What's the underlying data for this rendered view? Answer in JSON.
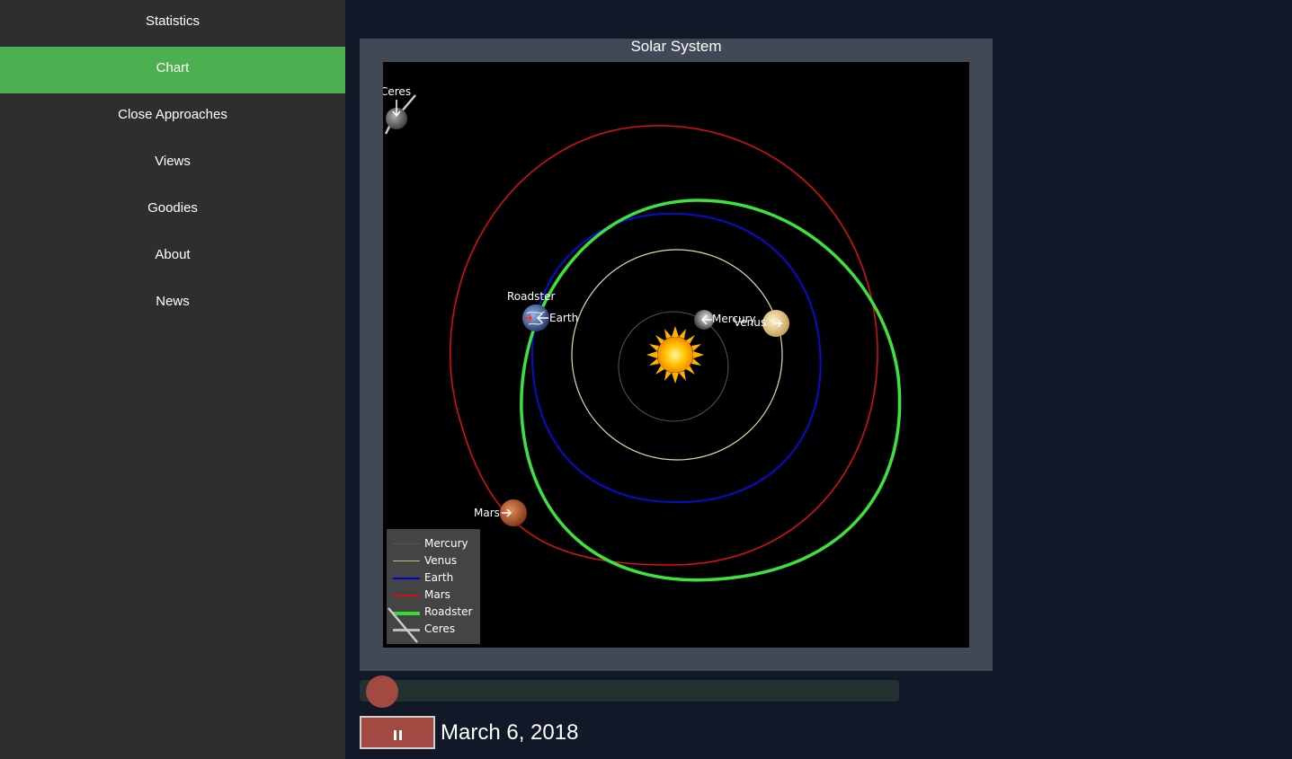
{
  "sidebar": {
    "items": [
      {
        "label": "Statistics",
        "active": false
      },
      {
        "label": "Chart",
        "active": true
      },
      {
        "label": "Close Approaches",
        "active": false
      },
      {
        "label": "Views",
        "active": false
      },
      {
        "label": "Goodies",
        "active": false
      },
      {
        "label": "About",
        "active": false
      },
      {
        "label": "News",
        "active": false
      }
    ],
    "accent_color": "#4caf50"
  },
  "chart": {
    "title": "Solar System",
    "legend": [
      {
        "name": "Mercury",
        "color": "#555555"
      },
      {
        "name": "Venus",
        "color": "#c8b878"
      },
      {
        "name": "Earth",
        "color": "#0000cc"
      },
      {
        "name": "Mars",
        "color": "#cc1111"
      },
      {
        "name": "Roadster",
        "color": "#33dd33"
      },
      {
        "name": "Ceres",
        "color": "#bbbbbb"
      }
    ]
  },
  "chart_data": {
    "type": "scatter",
    "title": "Solar System",
    "xlabel": "",
    "ylabel": "",
    "grid": false,
    "legend_position": "bottom-left",
    "series": [
      {
        "name": "Mercury",
        "kind": "orbit",
        "color": "#555555"
      },
      {
        "name": "Venus",
        "kind": "orbit",
        "color": "#c8b878"
      },
      {
        "name": "Earth",
        "kind": "orbit",
        "color": "#0000cc"
      },
      {
        "name": "Mars",
        "kind": "orbit",
        "color": "#cc1111"
      },
      {
        "name": "Roadster",
        "kind": "orbit",
        "color": "#33dd33"
      },
      {
        "name": "Ceres",
        "kind": "orbit",
        "color": "#bbbbbb"
      }
    ],
    "bodies": [
      {
        "name": "Sun",
        "icon": "sun-icon"
      },
      {
        "name": "Mercury",
        "icon": "mercury-icon"
      },
      {
        "name": "Venus",
        "icon": "venus-icon"
      },
      {
        "name": "Earth",
        "icon": "earth-icon"
      },
      {
        "name": "Roadster",
        "icon": "roadster-icon"
      },
      {
        "name": "Mars",
        "icon": "mars-icon"
      },
      {
        "name": "Ceres",
        "icon": "ceres-icon"
      }
    ]
  },
  "playback": {
    "date": "March 6, 2018",
    "progress": 0.0,
    "pause_icon": "pause-icon",
    "thumb_color": "#a24a42"
  }
}
